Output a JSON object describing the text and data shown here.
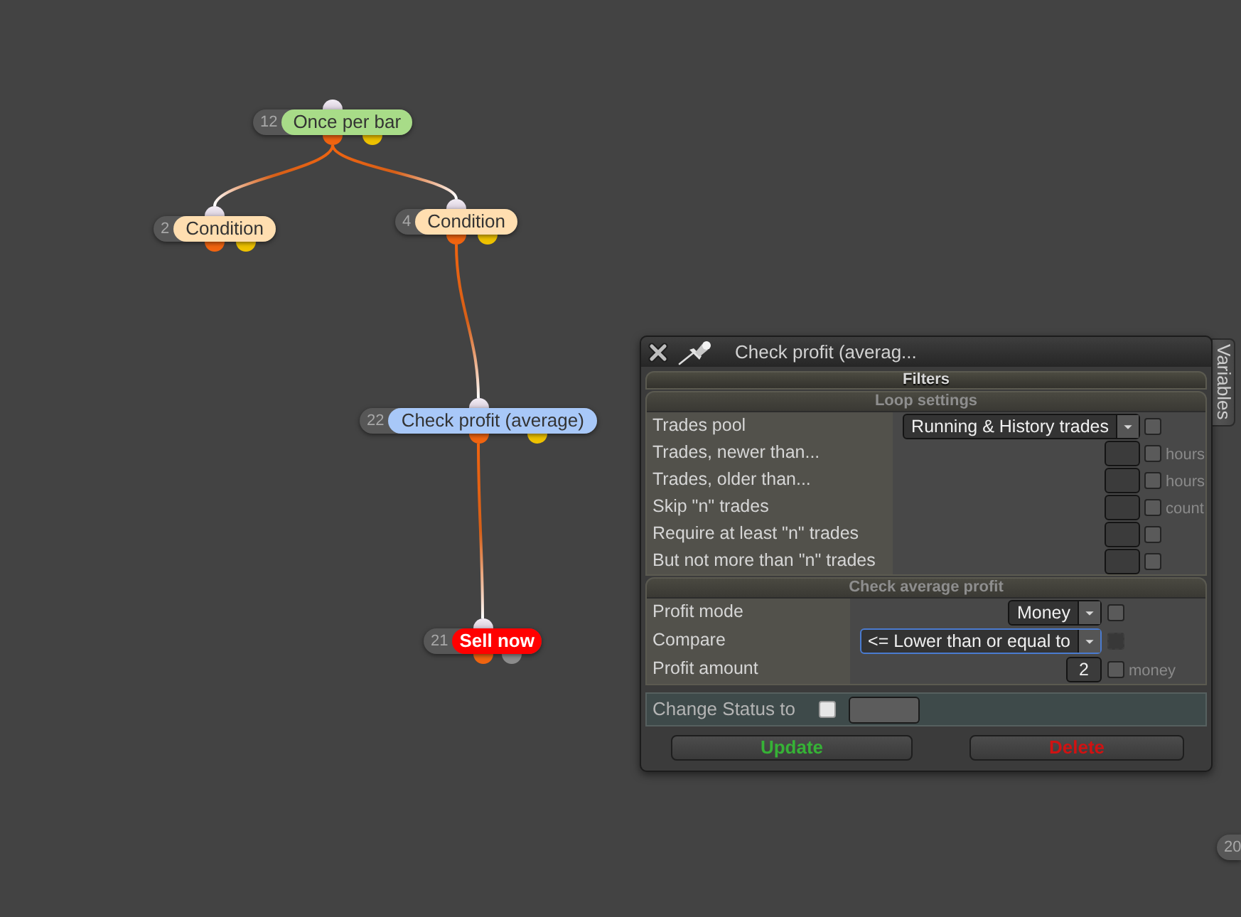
{
  "graph": {
    "nodes": [
      {
        "number": "12",
        "label": "Once per bar",
        "color": "#a8dc88",
        "outputs": [
          {
            "color": "#f06410"
          },
          {
            "color": "#eec200"
          }
        ],
        "children": [
          {
            "number": "2",
            "label": "Condition",
            "color": "#ffdeb0",
            "outputs": [
              {
                "color": "#f06410"
              },
              {
                "color": "#eec200"
              }
            ]
          },
          {
            "number": "4",
            "label": "Condition",
            "color": "#ffdeb0",
            "outputs": [
              {
                "color": "#f06410"
              },
              {
                "color": "#eec200"
              }
            ],
            "children": [
              {
                "number": "22",
                "label": "Check profit (average)",
                "color": "#a8c8f8",
                "outputs": [
                  {
                    "color": "#f06410"
                  },
                  {
                    "color": "#eec200"
                  }
                ],
                "children": [
                  {
                    "number": "21",
                    "label": "Sell now",
                    "color": "#ff0000",
                    "outputs": [
                      {
                        "color": "#f06410"
                      },
                      {
                        "color": "#8c8c8c"
                      }
                    ]
                  }
                ]
              }
            ]
          }
        ]
      },
      {
        "number": "20"
      }
    ]
  },
  "panel": {
    "title": "Check profit (averag...",
    "side_tab": "Variables",
    "header": "Filters",
    "sections": [
      {
        "title": "Loop settings",
        "rows": [
          {
            "label": "Trades pool",
            "kind": "select",
            "value": "Running & History trades",
            "focused": false,
            "checkbox": {
              "checked": false,
              "disabled": false
            }
          },
          {
            "label": "Trades, newer than...",
            "kind": "number",
            "focused": false,
            "checkbox": {
              "checked": false,
              "disabled": false
            },
            "unit": "hours"
          },
          {
            "label": "Trades, older than...",
            "kind": "number",
            "focused": false,
            "checkbox": {
              "checked": false,
              "disabled": false
            },
            "unit": "hours"
          },
          {
            "label": "Skip \"n\" trades",
            "kind": "number",
            "focused": false,
            "checkbox": {
              "checked": false,
              "disabled": false
            },
            "unit": "count"
          },
          {
            "label": "Require at least \"n\" trades",
            "kind": "number",
            "focused": false,
            "checkbox": {
              "checked": false,
              "disabled": false
            }
          },
          {
            "label": "But not more than \"n\" trades",
            "kind": "number",
            "focused": false,
            "checkbox": {
              "checked": false,
              "disabled": false
            }
          }
        ]
      },
      {
        "title": "Check average profit",
        "rows": [
          {
            "label": "Profit mode",
            "kind": "select",
            "value": "Money",
            "focused": false,
            "checkbox": {
              "checked": false,
              "disabled": false
            }
          },
          {
            "label": "Compare",
            "kind": "select",
            "value": "<= Lower than or equal to",
            "focused": true,
            "checkbox": {
              "checked": false,
              "disabled": true
            }
          },
          {
            "label": "Profit amount",
            "kind": "number",
            "value": "2",
            "focused": false,
            "checkbox": {
              "checked": false,
              "disabled": false
            },
            "unit": "money"
          }
        ]
      }
    ],
    "change_status": {
      "label": "Change Status to",
      "checkbox": {
        "checked": false
      }
    },
    "buttons": [
      {
        "label": "Update",
        "kind": "update"
      },
      {
        "label": "Delete",
        "kind": "delete"
      }
    ]
  }
}
